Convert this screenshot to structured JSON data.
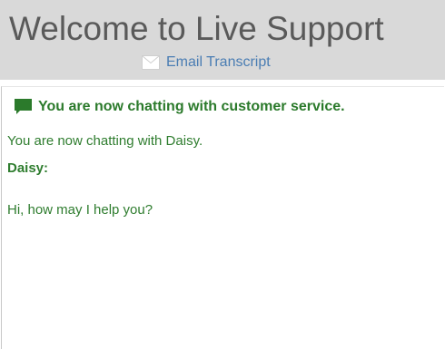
{
  "header": {
    "title": "Welcome to Live Support",
    "email_transcript_label": "Email Transcript"
  },
  "chat": {
    "system_message": "You are now chatting with customer service.",
    "connected_message": "You are now chatting with Daisy.",
    "agent_name": "Daisy:",
    "agent_message": "Hi, how may I help you?"
  },
  "colors": {
    "header_bg": "#d9d9d9",
    "title_text": "#5a5a5a",
    "link_blue": "#4a7db3",
    "chat_green": "#2b7a2b"
  },
  "icons": {
    "email": "envelope-icon",
    "chat": "speech-bubble-icon"
  }
}
